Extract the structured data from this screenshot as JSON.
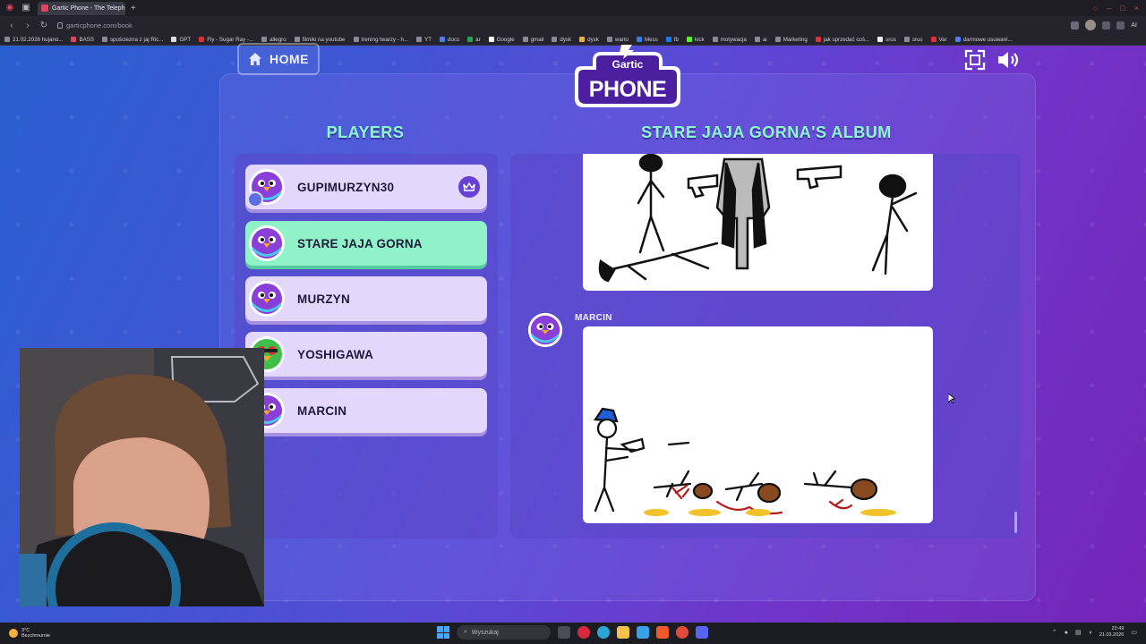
{
  "browser": {
    "tab_title": "Gartic Phone - The Teleph",
    "new_tab_symbol": "+",
    "url": "garticphone.com/book",
    "bookmarks": [
      "21.02.2026 hujano...",
      "BASS",
      "spuściezna z jaj Ric...",
      "GPT",
      "Fly - Sugar Ray -...",
      "allegro",
      "filmiki na youtube",
      "trening twarzy - h...",
      "YT",
      "docs",
      "ar",
      "Google",
      "gmail",
      "dysk",
      "dysk",
      "warto",
      "Mess",
      "fb",
      "kick",
      "motywacja",
      "ai",
      "Marketing",
      "jak sprzedać coś...",
      "srus",
      "srus",
      "Var",
      "darmowe usuwani..."
    ],
    "ext_label": "AI"
  },
  "app": {
    "home_label": "HOME",
    "logo_line1": "Gartic",
    "logo_line2": "PHONE",
    "players_heading": "PLAYERS",
    "album_heading": "STARE JAJA GORNA'S ALBUM",
    "players": [
      {
        "name": "GUPIMURZYN30",
        "host": true,
        "active": false
      },
      {
        "name": "STARE JAJA GORNA",
        "host": false,
        "active": true
      },
      {
        "name": "MURZYN",
        "host": false,
        "active": false
      },
      {
        "name": "YOSHIGAWA",
        "host": false,
        "active": false
      },
      {
        "name": "MARCIN",
        "host": false,
        "active": false
      }
    ],
    "album_author": "MARCIN"
  },
  "taskbar": {
    "weather_temp": "3°C",
    "weather_desc": "Bezchmurnie",
    "search_placeholder": "Wyszukaj",
    "time": "23:49",
    "date": "21.03.2026"
  },
  "colors": {
    "heading": "#8ef6d3",
    "player_card": "#e3d8fb",
    "player_active": "#8ff2c9",
    "crown_badge": "#6a3fd6"
  }
}
